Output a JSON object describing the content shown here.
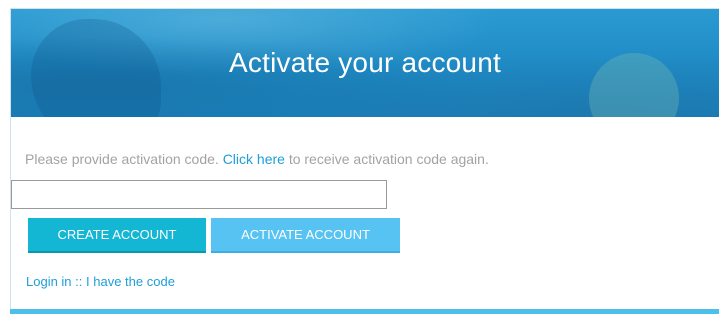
{
  "hero": {
    "title": "Activate your account"
  },
  "instructions": {
    "prefix": "Please provide activation code.",
    "link_text": "Click here",
    "suffix": "to receive activation code again."
  },
  "code_input": {
    "value": "",
    "placeholder": ""
  },
  "buttons": {
    "create_account": "CREATE ACCOUNT",
    "activate_account": "ACTIVATE ACCOUNT"
  },
  "footer": {
    "login_link": "Login in",
    "separator": "::",
    "have_code_link": "I have the code"
  },
  "colors": {
    "hero_blue": "#2a9ad2",
    "link_blue": "#1e9fd8",
    "create_button": "#13b6d3",
    "activate_button": "#56c3f3",
    "bottom_bar": "#4cc0e8",
    "muted_text": "#a3a3a3"
  }
}
